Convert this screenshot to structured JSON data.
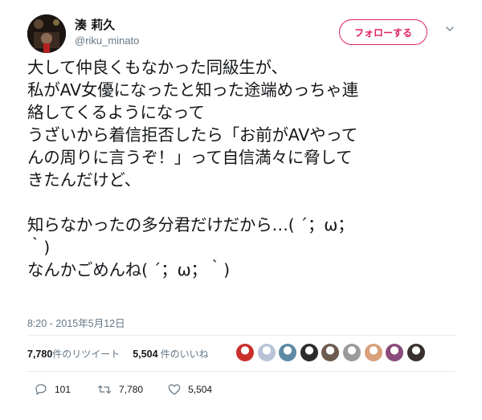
{
  "user": {
    "display_name": "湊 莉久",
    "handle": "@riku_minato"
  },
  "follow_button_label": "フォローする",
  "tweet": {
    "text": "大して仲良くもなかった同級生が、\n私がAV女優になったと知った途端めっちゃ連\n絡してくるようになって\nうざいから着信拒否したら「お前がAVやって\nんの周りに言うぞ！」って自信満々に脅して\nきたんだけど、\n\n知らなかったの多分君だけだから…( ´；ω；\n｀)\nなんかごめんね( ´；ω；｀)",
    "timestamp": "8:20 - 2015年5月12日"
  },
  "stats": {
    "retweet_count": "7,780",
    "retweet_label": "件のリツイート",
    "like_count": "5,504",
    "like_label": "件のいいね"
  },
  "likers": [
    {
      "icon": "liker-avatar",
      "color": "#c9302c"
    },
    {
      "icon": "liker-avatar",
      "color": "#b8c4d6"
    },
    {
      "icon": "liker-avatar",
      "color": "#5e8aa6"
    },
    {
      "icon": "liker-avatar",
      "color": "#2b2b2b"
    },
    {
      "icon": "liker-avatar",
      "color": "#6c5b4e"
    },
    {
      "icon": "liker-avatar",
      "color": "#9a9a9a"
    },
    {
      "icon": "liker-avatar",
      "color": "#d8a07a"
    },
    {
      "icon": "liker-avatar",
      "color": "#8a4a7a"
    },
    {
      "icon": "liker-avatar",
      "color": "#3a3030"
    }
  ],
  "actions": {
    "reply_count": "101",
    "retweet_count": "7,780",
    "like_count": "5,504"
  },
  "colors": {
    "accent": "#e0245e",
    "text": "#14171a",
    "muted": "#657786",
    "divider": "#e6ecf0"
  }
}
